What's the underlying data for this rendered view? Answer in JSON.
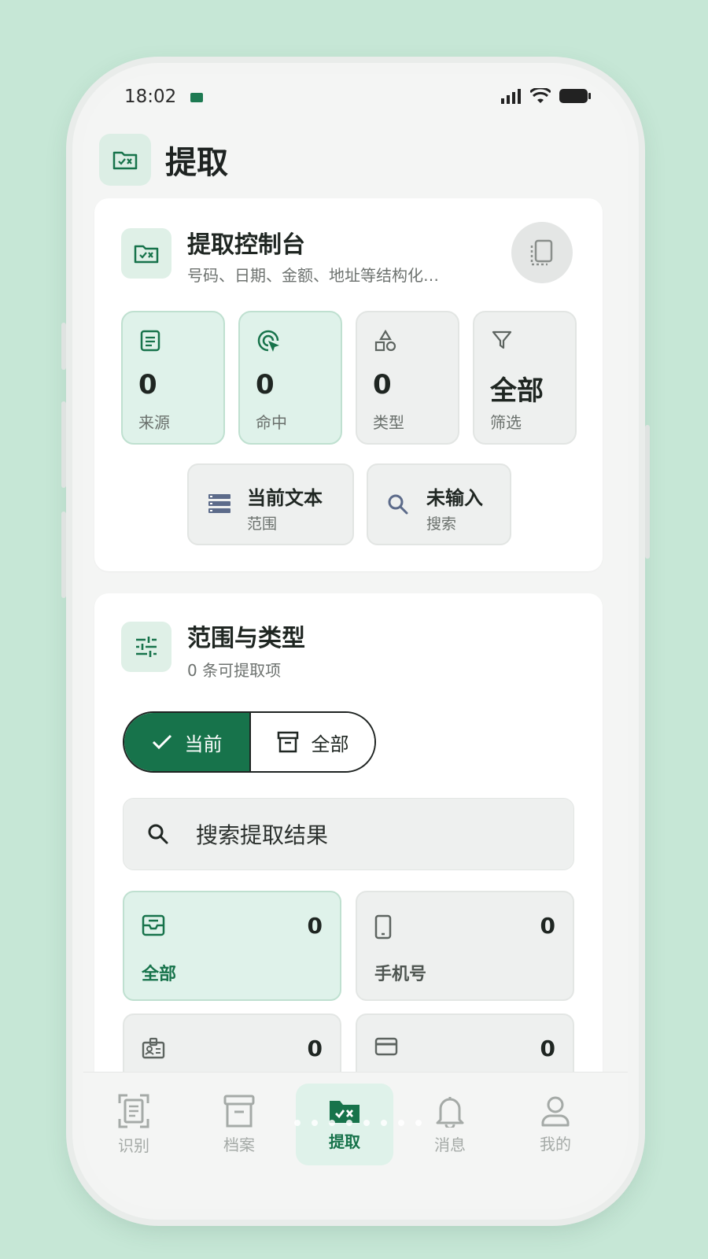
{
  "status_bar": {
    "time": "18:02"
  },
  "header": {
    "title": "提取"
  },
  "console": {
    "title": "提取控制台",
    "subtitle": "号码、日期、金额、地址等结构化…",
    "stats": [
      {
        "value": "0",
        "label": "来源",
        "icon": "document-icon"
      },
      {
        "value": "0",
        "label": "命中",
        "icon": "target-cursor-icon"
      },
      {
        "value": "0",
        "label": "类型",
        "icon": "shapes-icon"
      },
      {
        "value": "全部",
        "label": "筛选",
        "icon": "filter-icon"
      }
    ],
    "chips": [
      {
        "value": "当前文本",
        "label": "范围",
        "icon": "list-icon"
      },
      {
        "value": "未输入",
        "label": "搜索",
        "icon": "search-icon"
      }
    ]
  },
  "scope": {
    "title": "范围与类型",
    "subtitle": "0 条可提取项",
    "segments": [
      {
        "label": "当前",
        "selected": true
      },
      {
        "label": "全部",
        "selected": false
      }
    ],
    "search_placeholder": "搜索提取结果",
    "categories": [
      {
        "label": "全部",
        "count": "0",
        "icon": "inbox-icon",
        "active": true
      },
      {
        "label": "手机号",
        "count": "0",
        "icon": "phone-icon",
        "active": false
      },
      {
        "label": "",
        "count": "0",
        "icon": "id-card-icon",
        "active": false
      },
      {
        "label": "",
        "count": "0",
        "icon": "credit-card-icon",
        "active": false
      }
    ]
  },
  "tabbar": {
    "tabs": [
      {
        "label": "识别",
        "icon": "scan-icon"
      },
      {
        "label": "档案",
        "icon": "archive-icon"
      },
      {
        "label": "提取",
        "icon": "extract-folder-icon",
        "active": true
      },
      {
        "label": "消息",
        "icon": "bell-icon"
      },
      {
        "label": "我的",
        "icon": "user-icon"
      }
    ]
  },
  "colors": {
    "accent": "#17734b",
    "accent_light": "#dff2ea",
    "background": "#c6e7d6"
  }
}
